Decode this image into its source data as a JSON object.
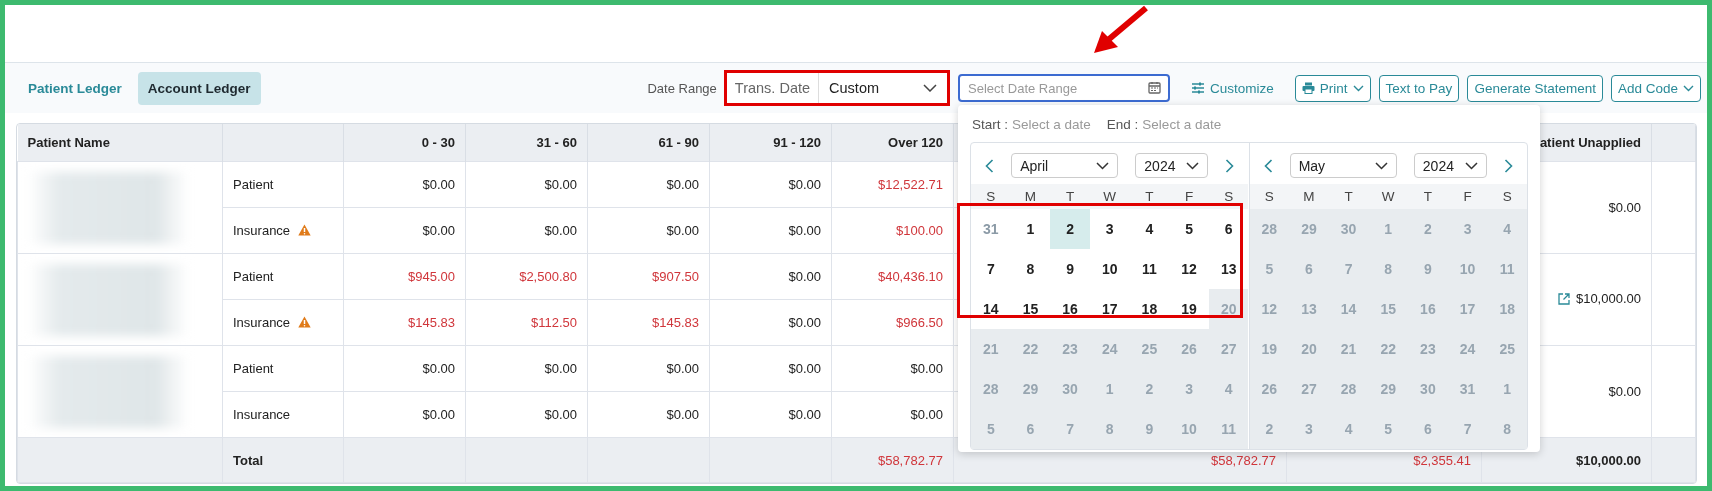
{
  "tabs": [
    {
      "label": "Patient Ledger",
      "selected": false
    },
    {
      "label": "Account Ledger",
      "selected": true
    }
  ],
  "date_range": {
    "label": "Date Range",
    "type": "Trans. Date",
    "preset": "Custom",
    "placeholder": "Select Date Range"
  },
  "actions": [
    {
      "label": "Customize",
      "kind": "customize"
    },
    {
      "label": "Print",
      "kind": "print"
    },
    {
      "label": "Text to Pay",
      "kind": "button"
    },
    {
      "label": "Generate Statement",
      "kind": "button"
    },
    {
      "label": "Add Code",
      "kind": "menu"
    }
  ],
  "table": {
    "columns": [
      "Patient Name",
      "0 - 30",
      "31 - 60",
      "61 - 90",
      "91 - 120",
      "Over 120",
      "atient Unapplied"
    ],
    "groups": [
      {
        "unapplied": "$0.00",
        "unapplied_link": false,
        "lines": [
          {
            "type": "Patient",
            "warning": false,
            "values": [
              {
                "v": "$0.00",
                "due": false
              },
              {
                "v": "$0.00",
                "due": false
              },
              {
                "v": "$0.00",
                "due": false
              },
              {
                "v": "$0.00",
                "due": false
              },
              {
                "v": "$12,522.71",
                "due": true
              }
            ]
          },
          {
            "type": "Insurance",
            "warning": true,
            "values": [
              {
                "v": "$0.00",
                "due": false
              },
              {
                "v": "$0.00",
                "due": false
              },
              {
                "v": "$0.00",
                "due": false
              },
              {
                "v": "$0.00",
                "due": false
              },
              {
                "v": "$100.00",
                "due": true
              }
            ]
          }
        ]
      },
      {
        "unapplied": "$10,000.00",
        "unapplied_link": true,
        "lines": [
          {
            "type": "Patient",
            "warning": false,
            "values": [
              {
                "v": "$945.00",
                "due": true
              },
              {
                "v": "$2,500.80",
                "due": true
              },
              {
                "v": "$907.50",
                "due": true
              },
              {
                "v": "$0.00",
                "due": false
              },
              {
                "v": "$40,436.10",
                "due": true
              }
            ]
          },
          {
            "type": "Insurance",
            "warning": true,
            "values": [
              {
                "v": "$145.83",
                "due": true
              },
              {
                "v": "$112.50",
                "due": true
              },
              {
                "v": "$145.83",
                "due": true
              },
              {
                "v": "$0.00",
                "due": false
              },
              {
                "v": "$966.50",
                "due": true
              }
            ]
          }
        ]
      },
      {
        "unapplied": "$0.00",
        "unapplied_link": false,
        "lines": [
          {
            "type": "Patient",
            "warning": false,
            "values": [
              {
                "v": "$0.00",
                "due": false
              },
              {
                "v": "$0.00",
                "due": false
              },
              {
                "v": "$0.00",
                "due": false
              },
              {
                "v": "$0.00",
                "due": false
              },
              {
                "v": "$0.00",
                "due": false
              }
            ]
          },
          {
            "type": "Insurance",
            "warning": false,
            "values": [
              {
                "v": "$0.00",
                "due": false
              },
              {
                "v": "$0.00",
                "due": false
              },
              {
                "v": "$0.00",
                "due": false
              },
              {
                "v": "$0.00",
                "due": false
              },
              {
                "v": "$0.00",
                "due": false
              }
            ]
          }
        ]
      }
    ],
    "total_label": "Total",
    "totals": {
      "over_120": {
        "v": "$58,782.77",
        "due": true
      },
      "column_7": {
        "v": "$58,782.77",
        "due": true
      },
      "column_8": {
        "v": "$2,355.41",
        "due": true
      },
      "unapplied": {
        "v": "$10,000.00",
        "due": false
      }
    }
  },
  "calendar": {
    "start_label": "Start :",
    "start_value": "Select a date",
    "end_label": "End :",
    "end_value": "Select a date",
    "months": [
      {
        "month": "April",
        "year": "2024",
        "weekdays": [
          "S",
          "M",
          "T",
          "W",
          "T",
          "F",
          "S"
        ],
        "weeks": [
          [
            {
              "d": "31",
              "kind": "outside",
              "today": false
            },
            {
              "d": "1",
              "kind": "normal",
              "today": false
            },
            {
              "d": "2",
              "kind": "normal",
              "today": true
            },
            {
              "d": "3",
              "kind": "normal",
              "today": false
            },
            {
              "d": "4",
              "kind": "normal",
              "today": false
            },
            {
              "d": "5",
              "kind": "normal",
              "today": false
            },
            {
              "d": "6",
              "kind": "normal",
              "today": false
            }
          ],
          [
            {
              "d": "7",
              "kind": "normal",
              "today": false
            },
            {
              "d": "8",
              "kind": "normal",
              "today": false
            },
            {
              "d": "9",
              "kind": "normal",
              "today": false
            },
            {
              "d": "10",
              "kind": "normal",
              "today": false
            },
            {
              "d": "11",
              "kind": "normal",
              "today": false
            },
            {
              "d": "12",
              "kind": "normal",
              "today": false
            },
            {
              "d": "13",
              "kind": "normal",
              "today": false
            }
          ],
          [
            {
              "d": "14",
              "kind": "normal",
              "today": false
            },
            {
              "d": "15",
              "kind": "normal",
              "today": false
            },
            {
              "d": "16",
              "kind": "normal",
              "today": false
            },
            {
              "d": "17",
              "kind": "normal",
              "today": false
            },
            {
              "d": "18",
              "kind": "normal",
              "today": false
            },
            {
              "d": "19",
              "kind": "normal",
              "today": false
            },
            {
              "d": "20",
              "kind": "disabled",
              "today": false
            }
          ],
          [
            {
              "d": "21",
              "kind": "disabled",
              "today": false
            },
            {
              "d": "22",
              "kind": "disabled",
              "today": false
            },
            {
              "d": "23",
              "kind": "disabled",
              "today": false
            },
            {
              "d": "24",
              "kind": "disabled",
              "today": false
            },
            {
              "d": "25",
              "kind": "disabled",
              "today": false
            },
            {
              "d": "26",
              "kind": "disabled",
              "today": false
            },
            {
              "d": "27",
              "kind": "disabled",
              "today": false
            }
          ],
          [
            {
              "d": "28",
              "kind": "disabled",
              "today": false
            },
            {
              "d": "29",
              "kind": "disabled",
              "today": false
            },
            {
              "d": "30",
              "kind": "disabled",
              "today": false
            },
            {
              "d": "1",
              "kind": "disabled",
              "today": false
            },
            {
              "d": "2",
              "kind": "disabled",
              "today": false
            },
            {
              "d": "3",
              "kind": "disabled",
              "today": false
            },
            {
              "d": "4",
              "kind": "disabled",
              "today": false
            }
          ],
          [
            {
              "d": "5",
              "kind": "disabled",
              "today": false
            },
            {
              "d": "6",
              "kind": "disabled",
              "today": false
            },
            {
              "d": "7",
              "kind": "disabled",
              "today": false
            },
            {
              "d": "8",
              "kind": "disabled",
              "today": false
            },
            {
              "d": "9",
              "kind": "disabled",
              "today": false
            },
            {
              "d": "10",
              "kind": "disabled",
              "today": false
            },
            {
              "d": "11",
              "kind": "disabled",
              "today": false
            }
          ]
        ]
      },
      {
        "month": "May",
        "year": "2024",
        "weekdays": [
          "S",
          "M",
          "T",
          "W",
          "T",
          "F",
          "S"
        ],
        "weeks": [
          [
            {
              "d": "28",
              "kind": "disabled",
              "today": false
            },
            {
              "d": "29",
              "kind": "disabled",
              "today": false
            },
            {
              "d": "30",
              "kind": "disabled",
              "today": false
            },
            {
              "d": "1",
              "kind": "disabled",
              "today": false
            },
            {
              "d": "2",
              "kind": "disabled",
              "today": false
            },
            {
              "d": "3",
              "kind": "disabled",
              "today": false
            },
            {
              "d": "4",
              "kind": "disabled",
              "today": false
            }
          ],
          [
            {
              "d": "5",
              "kind": "disabled",
              "today": false
            },
            {
              "d": "6",
              "kind": "disabled",
              "today": false
            },
            {
              "d": "7",
              "kind": "disabled",
              "today": false
            },
            {
              "d": "8",
              "kind": "disabled",
              "today": false
            },
            {
              "d": "9",
              "kind": "disabled",
              "today": false
            },
            {
              "d": "10",
              "kind": "disabled",
              "today": false
            },
            {
              "d": "11",
              "kind": "disabled",
              "today": false
            }
          ],
          [
            {
              "d": "12",
              "kind": "disabled",
              "today": false
            },
            {
              "d": "13",
              "kind": "disabled",
              "today": false
            },
            {
              "d": "14",
              "kind": "disabled",
              "today": false
            },
            {
              "d": "15",
              "kind": "disabled",
              "today": false
            },
            {
              "d": "16",
              "kind": "disabled",
              "today": false
            },
            {
              "d": "17",
              "kind": "disabled",
              "today": false
            },
            {
              "d": "18",
              "kind": "disabled",
              "today": false
            }
          ],
          [
            {
              "d": "19",
              "kind": "disabled",
              "today": false
            },
            {
              "d": "20",
              "kind": "disabled",
              "today": false
            },
            {
              "d": "21",
              "kind": "disabled",
              "today": false
            },
            {
              "d": "22",
              "kind": "disabled",
              "today": false
            },
            {
              "d": "23",
              "kind": "disabled",
              "today": false
            },
            {
              "d": "24",
              "kind": "disabled",
              "today": false
            },
            {
              "d": "25",
              "kind": "disabled",
              "today": false
            }
          ],
          [
            {
              "d": "26",
              "kind": "disabled",
              "today": false
            },
            {
              "d": "27",
              "kind": "disabled",
              "today": false
            },
            {
              "d": "28",
              "kind": "disabled",
              "today": false
            },
            {
              "d": "29",
              "kind": "disabled",
              "today": false
            },
            {
              "d": "30",
              "kind": "disabled",
              "today": false
            },
            {
              "d": "31",
              "kind": "disabled",
              "today": false
            },
            {
              "d": "1",
              "kind": "disabled",
              "today": false
            }
          ],
          [
            {
              "d": "2",
              "kind": "disabled",
              "today": false
            },
            {
              "d": "3",
              "kind": "disabled",
              "today": false
            },
            {
              "d": "4",
              "kind": "disabled",
              "today": false
            },
            {
              "d": "5",
              "kind": "disabled",
              "today": false
            },
            {
              "d": "6",
              "kind": "disabled",
              "today": false
            },
            {
              "d": "7",
              "kind": "disabled",
              "today": false
            },
            {
              "d": "8",
              "kind": "disabled",
              "today": false
            }
          ]
        ]
      }
    ]
  }
}
